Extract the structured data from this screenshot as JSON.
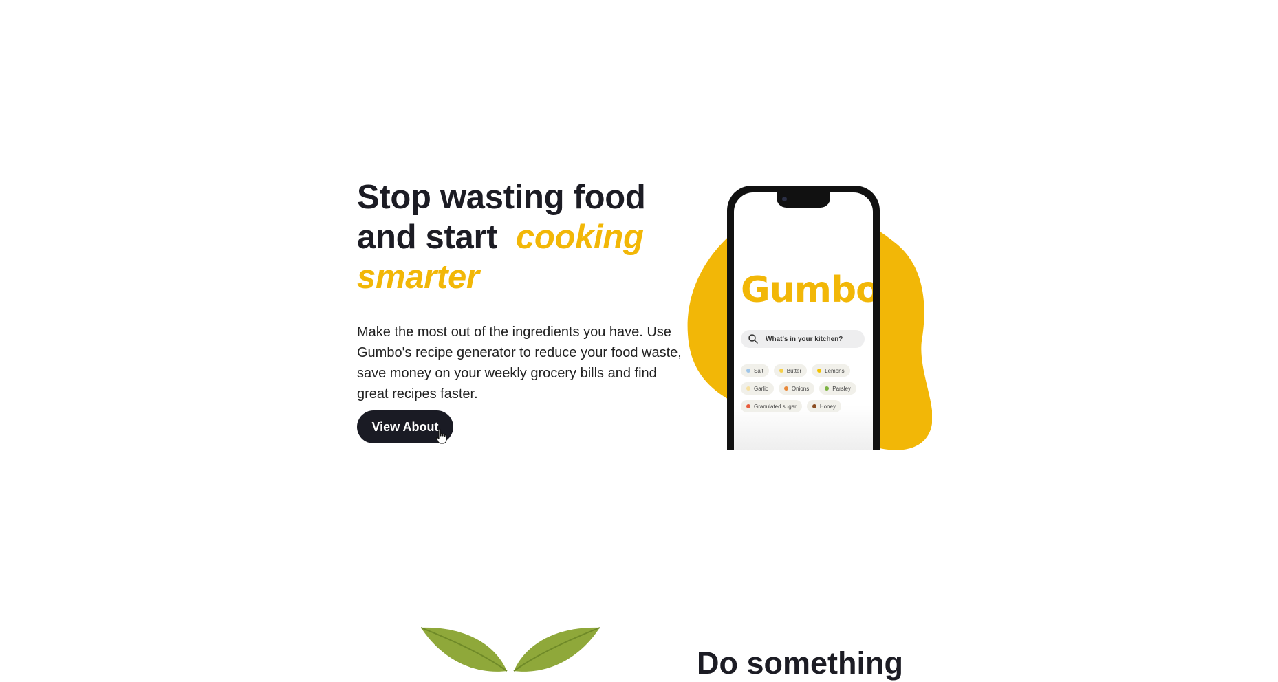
{
  "hero": {
    "headline_line1": "Stop wasting food",
    "headline_line2_plain": "and start",
    "headline_line2_accent": "cooking",
    "headline_line3_accent": "smarter",
    "body": "Make the most out of the ingredients you have. Use Gumbo's recipe generator to reduce your food waste, save money on your weekly grocery bills and find great recipes faster.",
    "cta_label": "View About"
  },
  "phone": {
    "app_name": "Gumbo",
    "search_placeholder": "What's in your kitchen?",
    "ingredients": [
      [
        "Salt",
        "Butter",
        "Lemons"
      ],
      [
        "Garlic",
        "Onions",
        "Parsley"
      ],
      [
        "Granulated sugar",
        "Honey"
      ]
    ]
  },
  "section2": {
    "heading": "Do something"
  },
  "colors": {
    "accent": "#f2b707",
    "dark": "#1a1b24",
    "leaf": "#8fa83a"
  },
  "icons": {
    "search": "search-icon",
    "cursor": "hand-cursor-icon",
    "leaves": "leaf-icon"
  }
}
